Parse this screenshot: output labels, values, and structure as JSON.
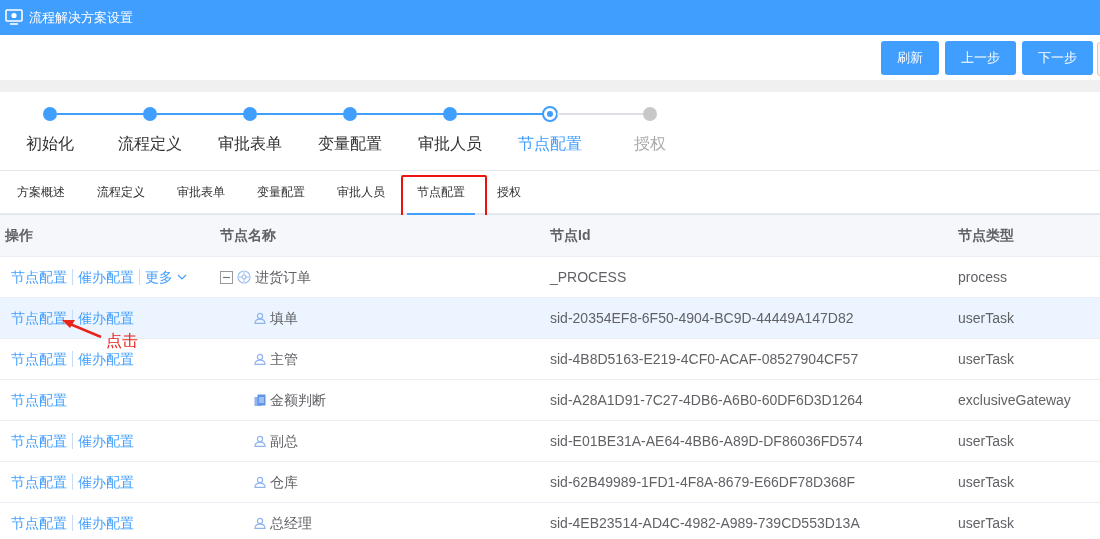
{
  "window": {
    "title": "流程解决方案设置"
  },
  "buttons": [
    "刷新",
    "上一步",
    "下一步"
  ],
  "steps": [
    {
      "label": "初始化",
      "done": true,
      "selected": false
    },
    {
      "label": "流程定义",
      "done": true,
      "selected": false
    },
    {
      "label": "审批表单",
      "done": true,
      "selected": false
    },
    {
      "label": "变量配置",
      "done": true,
      "selected": false
    },
    {
      "label": "审批人员",
      "done": true,
      "selected": false
    },
    {
      "label": "节点配置",
      "done": false,
      "selected": true
    },
    {
      "label": "授权",
      "done": false,
      "selected": false
    }
  ],
  "tabs": [
    {
      "label": "方案概述",
      "selected": false,
      "boxed": false
    },
    {
      "label": "流程定义",
      "selected": false,
      "boxed": false
    },
    {
      "label": "审批表单",
      "selected": false,
      "boxed": false
    },
    {
      "label": "变量配置",
      "selected": false,
      "boxed": false
    },
    {
      "label": "审批人员",
      "selected": false,
      "boxed": false
    },
    {
      "label": "节点配置",
      "selected": true,
      "boxed": true
    },
    {
      "label": "授权",
      "selected": false,
      "boxed": false
    }
  ],
  "table": {
    "columns": [
      "操作",
      "节点名称",
      "节点Id",
      "节点类型"
    ],
    "rows": [
      {
        "actions": [
          {
            "kind": "link",
            "label": "节点配置"
          },
          {
            "kind": "link",
            "label": "催办配置"
          },
          {
            "kind": "dropdown",
            "label": "更多"
          }
        ],
        "kind": "process",
        "expanded": true,
        "name": "进货订单",
        "id": "_PROCESS",
        "type": "process",
        "highlighted": false
      },
      {
        "actions": [
          {
            "kind": "link",
            "label": "节点配置"
          },
          {
            "kind": "link",
            "label": "催办配置"
          }
        ],
        "kind": "user",
        "name": "填单",
        "id": "sid-20354EF8-6F50-4904-BC9D-44449A147D82",
        "type": "userTask",
        "highlighted": true
      },
      {
        "actions": [
          {
            "kind": "link",
            "label": "节点配置"
          },
          {
            "kind": "link",
            "label": "催办配置"
          }
        ],
        "kind": "user",
        "name": "主管",
        "id": "sid-4B8D5163-E219-4CF0-ACAF-08527904CF57",
        "type": "userTask",
        "highlighted": false
      },
      {
        "actions": [
          {
            "kind": "link",
            "label": "节点配置"
          }
        ],
        "kind": "gateway",
        "name": "金额判断",
        "id": "sid-A28A1D91-7C27-4DB6-A6B0-60DF6D3D1264",
        "type": "exclusiveGateway",
        "highlighted": false
      },
      {
        "actions": [
          {
            "kind": "link",
            "label": "节点配置"
          },
          {
            "kind": "link",
            "label": "催办配置"
          }
        ],
        "kind": "user",
        "name": "副总",
        "id": "sid-E01BE31A-AE64-4BB6-A89D-DF86036FD574",
        "type": "userTask",
        "highlighted": false
      },
      {
        "actions": [
          {
            "kind": "link",
            "label": "节点配置"
          },
          {
            "kind": "link",
            "label": "催办配置"
          }
        ],
        "kind": "user",
        "name": "仓库",
        "id": "sid-62B49989-1FD1-4F8A-8679-E66DF78D368F",
        "type": "userTask",
        "highlighted": false
      },
      {
        "actions": [
          {
            "kind": "link",
            "label": "节点配置"
          },
          {
            "kind": "link",
            "label": "催办配置"
          }
        ],
        "kind": "user",
        "name": "总经理",
        "id": "sid-4EB23514-AD4C-4982-A989-739CD553D13A",
        "type": "userTask",
        "highlighted": false
      }
    ]
  },
  "annotation": {
    "text": "点击"
  }
}
